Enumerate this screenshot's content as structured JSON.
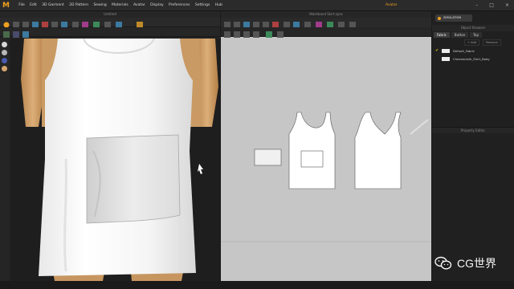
{
  "menu": {
    "items": [
      "File",
      "Edit",
      "3D Garment",
      "2D Pattern",
      "Sewing",
      "Materials",
      "Avatar",
      "Display",
      "Preferences",
      "Settings",
      "Hub"
    ],
    "mode_label": "Avatar"
  },
  "pane3d": {
    "title": "Untitled"
  },
  "pane2d": {
    "title": "Waistband Skirt.zpac"
  },
  "right_panel": {
    "simulation_label": "SIMULATION",
    "object_browser_title": "Object Browser",
    "tabs": [
      "Fabric",
      "Button",
      "Top"
    ],
    "actions": [
      "+ Add",
      "Remove"
    ],
    "fabrics": [
      {
        "name": "Default_Fabric",
        "checked": true
      },
      {
        "name": "Cheesecloth_Shirt_Body",
        "checked": false
      }
    ],
    "property_editor_title": "Property Editor"
  },
  "watermark": {
    "text": "CG世界"
  },
  "colors": {
    "accent": "#f0a020",
    "garment": "#ffffff",
    "skin": "#d6a66e",
    "board": "#c6c6c6"
  },
  "icons": [
    "logo-icon",
    "hand-icon",
    "simulation-icon",
    "wechat-icon"
  ]
}
